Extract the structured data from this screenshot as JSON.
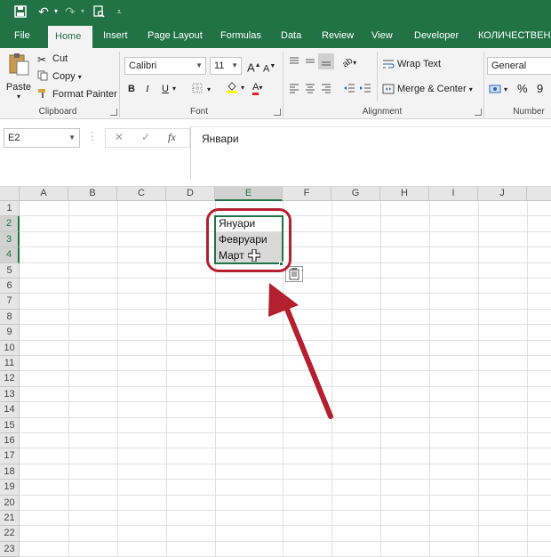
{
  "ribbon": {
    "tabs": [
      "File",
      "Home",
      "Insert",
      "Page Layout",
      "Formulas",
      "Data",
      "Review",
      "View",
      "Developer",
      "КОЛИЧЕСТВЕНИ"
    ],
    "active_tab": "Home",
    "clipboard": {
      "paste": "Paste",
      "cut": "Cut",
      "copy": "Copy",
      "format_painter": "Format Painter",
      "label": "Clipboard"
    },
    "font": {
      "name": "Calibri",
      "size": "11",
      "bold": "B",
      "italic": "I",
      "underline": "U",
      "grow": "A",
      "shrink": "A",
      "font_color": "A",
      "label": "Font"
    },
    "alignment": {
      "wrap_text": "Wrap Text",
      "merge_center": "Merge & Center",
      "label": "Alignment"
    },
    "number": {
      "format": "General",
      "percent": "%",
      "comma": "9",
      "label": "Number"
    }
  },
  "formula_bar": {
    "name_box": "E2",
    "fx": "fx",
    "cancel": "✕",
    "enter": "✓",
    "value": "Январи"
  },
  "sheet": {
    "columns": [
      "A",
      "B",
      "C",
      "D",
      "E",
      "F",
      "G",
      "H",
      "I",
      "J"
    ],
    "selected_column": "E",
    "rows": [
      "1",
      "2",
      "3",
      "4",
      "5",
      "6",
      "7",
      "8",
      "9",
      "10",
      "11",
      "12",
      "13",
      "14",
      "15",
      "16",
      "17",
      "18",
      "19",
      "20",
      "21",
      "22",
      "23"
    ],
    "cells": {
      "E2": "Януари",
      "E3": "Февруари",
      "E4": "Март"
    }
  },
  "colors": {
    "excel_green": "#217346",
    "annotation_red": "#b5202e",
    "selection_fill": "#d9d9d9"
  }
}
